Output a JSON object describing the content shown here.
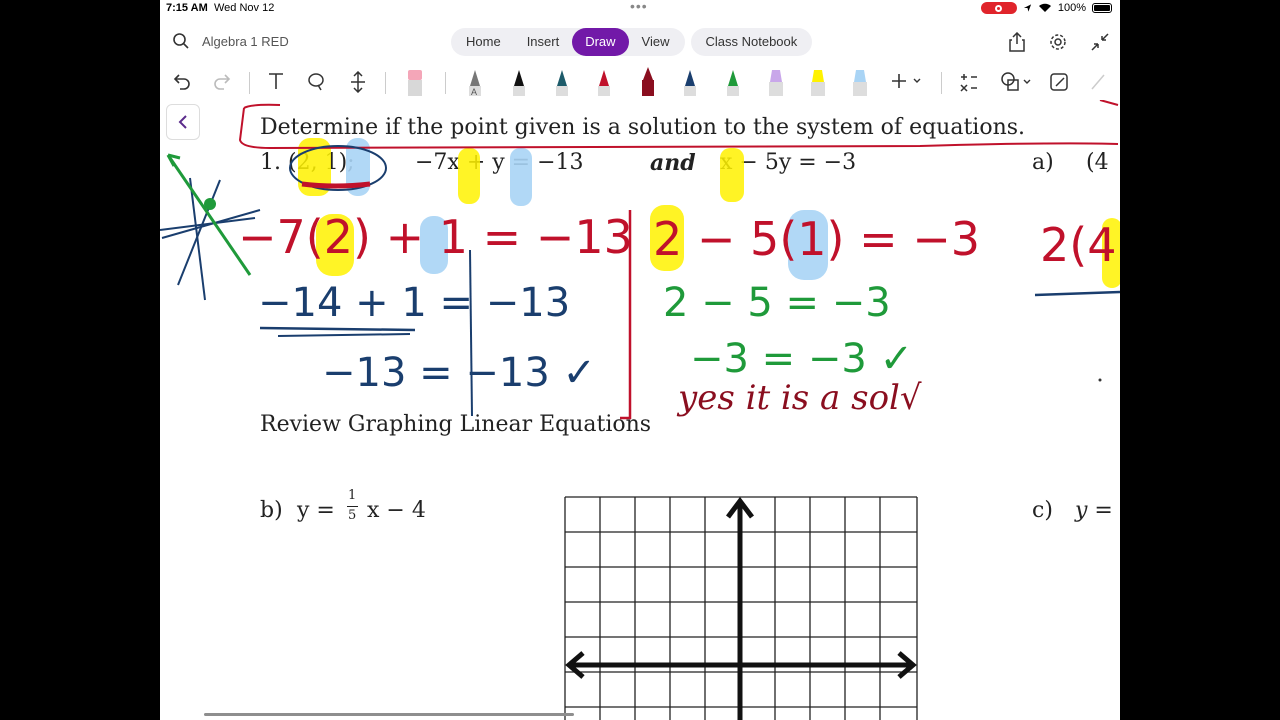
{
  "status": {
    "time": "7:15 AM",
    "date": "Wed Nov 12",
    "battery": "100%"
  },
  "search": {
    "notebook": "Algebra 1 RED"
  },
  "tabs": [
    {
      "label": "Home"
    },
    {
      "label": "Insert"
    },
    {
      "label": "Draw",
      "active": true
    },
    {
      "label": "View"
    }
  ],
  "class_notebook": "Class Notebook",
  "worksheet": {
    "instructions": "Determine if the point given is a solution to the system of equations.",
    "problem1": {
      "number": "1.",
      "point": "(2, 1);",
      "eq1": "−7x + y = −13",
      "and": "and",
      "eq2": "x − 5y = −3"
    },
    "part_a": {
      "label": "a)",
      "point": "(4"
    },
    "section_title": "Review Graphing Linear Equations",
    "part_b": {
      "label": "b)",
      "eq": "y = ",
      "frac_num": "1",
      "frac_den": "5",
      "eq_tail": "x − 4"
    },
    "part_c": {
      "label": "c)",
      "eq": "y ="
    }
  },
  "ink": {
    "left_line1": "−7(2) + 1 = −13",
    "left_line2": "−14 + 1  = −13",
    "left_line3": "−13  = −13 ✓",
    "right_line1": "2 − 5(1) = −3",
    "right_line2": "2 − 5 = −3",
    "right_line3": "−3 = −3 ✓",
    "conclusion": "yes it is a sol√",
    "far_right": "2(4"
  },
  "colors": {
    "accent": "#7219a8",
    "ink_red": "#c0112b",
    "ink_blue": "#1a3e6e",
    "ink_green": "#1f9a3a",
    "hl_yellow": "#fff200",
    "hl_blue": "#a9d4f5"
  }
}
